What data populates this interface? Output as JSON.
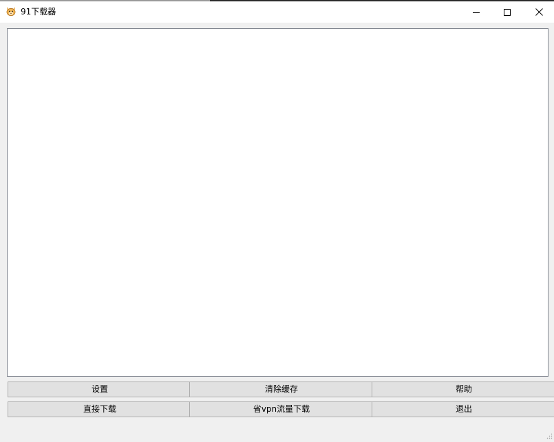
{
  "window": {
    "title": "91下载器",
    "app_icon": "cat-face-icon",
    "controls": {
      "minimize_icon": "minimize-icon",
      "maximize_icon": "maximize-icon",
      "close_icon": "close-icon"
    }
  },
  "log": {
    "content": ""
  },
  "buttons": {
    "settings": "设置",
    "clear_cache": "清除缓存",
    "help": "帮助",
    "direct_download": "直接下载",
    "save_vpn_download": "省vpn流量下载",
    "exit": "退出"
  },
  "colors": {
    "titlebar_bg": "#ffffff",
    "window_bg": "#f0f0f0",
    "button_bg": "#e1e1e1",
    "button_border": "#adadad"
  }
}
